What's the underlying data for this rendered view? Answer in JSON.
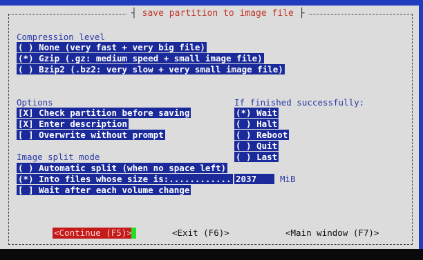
{
  "title": "save partition to image file",
  "compression": {
    "label": "Compression level",
    "options": [
      {
        "text": "( ) None (very fast + very big file)"
      },
      {
        "text": "(*) Gzip (.gz: medium speed + small image file)"
      },
      {
        "text": "( ) Bzip2 (.bz2: very slow + very small image file)"
      }
    ]
  },
  "options": {
    "label": "Options",
    "items": [
      {
        "text": "[X] Check partition before saving"
      },
      {
        "text": "[X] Enter description"
      },
      {
        "text": "[ ] Overwrite without prompt"
      }
    ]
  },
  "finished": {
    "label": "If finished successfully:",
    "items": [
      {
        "text": "(*) Wait"
      },
      {
        "text": "( ) Halt"
      },
      {
        "text": "( ) Reboot"
      },
      {
        "text": "( ) Quit"
      },
      {
        "text": "( ) Last"
      }
    ]
  },
  "split": {
    "label": "Image split mode",
    "items": [
      {
        "text": "( ) Automatic split (when no space left)"
      },
      {
        "text": "(*) Into files whose size is:............"
      },
      {
        "text": "[ ] Wait after each volume change"
      }
    ],
    "size_value": "2037",
    "size_unit": "MiB"
  },
  "buttons": {
    "continue": "<Continue (F5)>",
    "exit": "<Exit (F6)>",
    "main": "<Main window (F7)>"
  },
  "colors": {
    "selection_bg": "#1b2a9b",
    "label_text": "#2a3aa6",
    "title_text": "#c0392b",
    "active_button_bg": "#c41a1a",
    "cursor": "#22e022"
  }
}
